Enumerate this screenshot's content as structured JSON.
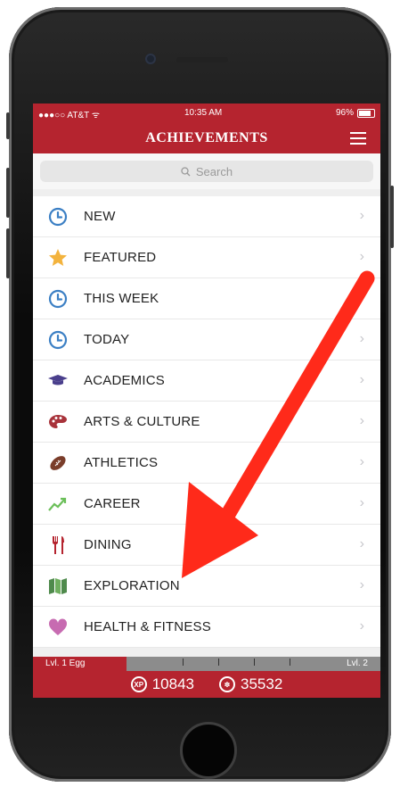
{
  "status_bar": {
    "carrier": "●●●○○ AT&T ᯤ",
    "time": "10:35 AM",
    "battery": "96%"
  },
  "header": {
    "title": "ACHIEVEMENTS"
  },
  "search": {
    "placeholder": "Search"
  },
  "categories": [
    {
      "label": "NEW",
      "icon": "clock-icon"
    },
    {
      "label": "FEATURED",
      "icon": "star-icon"
    },
    {
      "label": "THIS WEEK",
      "icon": "clock-icon"
    },
    {
      "label": "TODAY",
      "icon": "clock-icon"
    },
    {
      "label": "ACADEMICS",
      "icon": "graduation-cap-icon"
    },
    {
      "label": "ARTS & CULTURE",
      "icon": "palette-icon"
    },
    {
      "label": "ATHLETICS",
      "icon": "football-icon"
    },
    {
      "label": "CAREER",
      "icon": "trend-up-icon"
    },
    {
      "label": "DINING",
      "icon": "fork-knife-icon"
    },
    {
      "label": "EXPLORATION",
      "icon": "map-icon"
    },
    {
      "label": "HEALTH & FITNESS",
      "icon": "heart-icon"
    }
  ],
  "progress": {
    "left_label": "Lvl. 1 Egg",
    "right_label": "Lvl. 2",
    "fraction": 0.27
  },
  "stats": {
    "xp_icon": "XP",
    "xp": "10843",
    "points": "35532"
  },
  "colors": {
    "brand": "#b5242f",
    "arrow": "#ff2a1a"
  }
}
